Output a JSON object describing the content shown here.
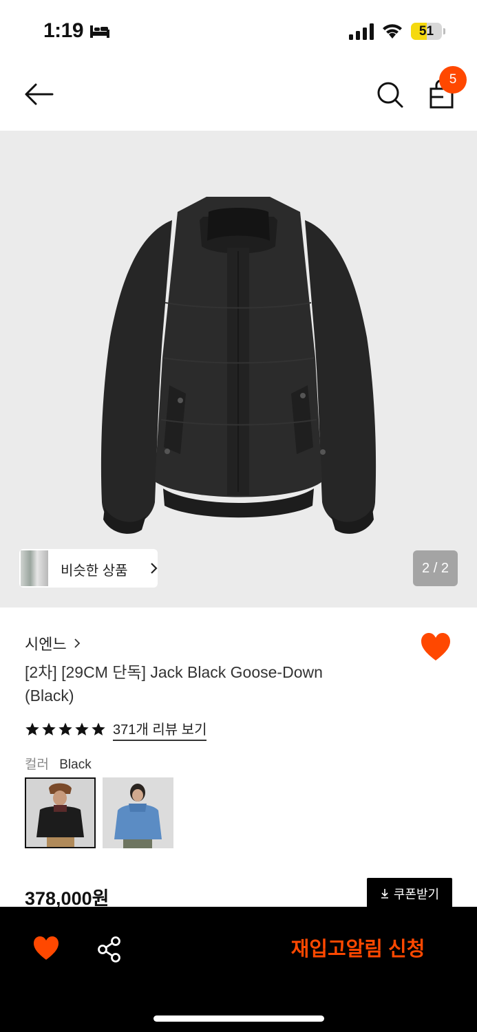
{
  "status_bar": {
    "time": "1:19",
    "battery_level": "51",
    "battery_fraction": 0.51
  },
  "nav": {
    "cart_count": "5"
  },
  "gallery": {
    "similar_label": "비슷한 상품",
    "page_counter": "2 / 2"
  },
  "product": {
    "brand": "시엔느",
    "title": "[2차] [29CM 단독] Jack Black Goose-Down (Black)",
    "rating_stars": 5,
    "review_link": "371개 리뷰 보기",
    "color_label": "컬러",
    "color_value": "Black",
    "price": "378,000원",
    "coupon_label": "쿠폰받기"
  },
  "bottom_bar": {
    "restock_label": "재입고알림 신청"
  },
  "colors": {
    "accent": "#ff4800",
    "bottom_bar": "#000000",
    "image_bg": "#ebebeb"
  }
}
